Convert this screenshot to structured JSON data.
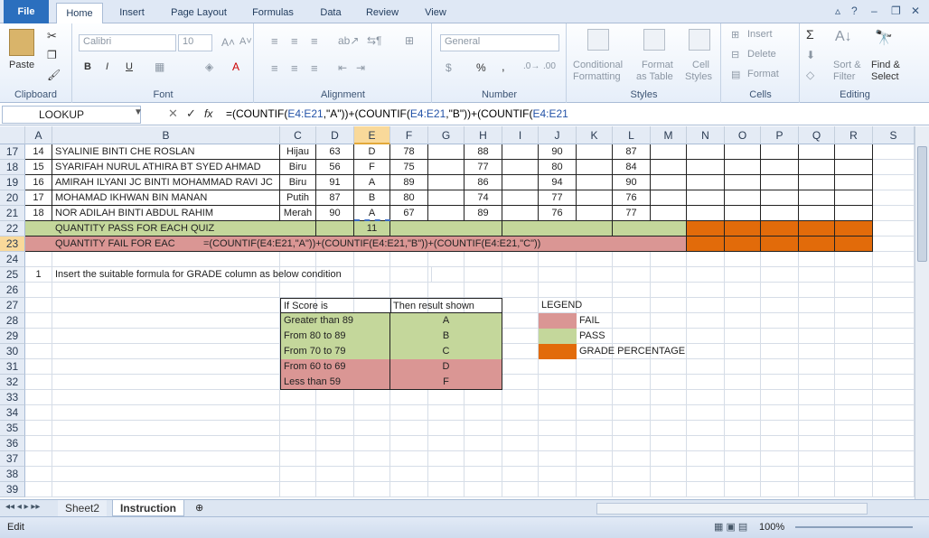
{
  "tabs": {
    "file": "File",
    "home": "Home",
    "insert": "Insert",
    "page_layout": "Page Layout",
    "formulas": "Formulas",
    "data": "Data",
    "review": "Review",
    "view": "View"
  },
  "ribbon": {
    "clipboard": {
      "label": "Clipboard",
      "paste": "Paste"
    },
    "font": {
      "label": "Font",
      "name": "Calibri",
      "size": "10",
      "bold": "B",
      "italic": "I",
      "underline": "U"
    },
    "alignment": {
      "label": "Alignment"
    },
    "number": {
      "label": "Number",
      "format": "General",
      "percent": "%",
      "comma": ","
    },
    "styles": {
      "label": "Styles",
      "conditional": "Conditional",
      "conditional2": "Formatting",
      "format_as": "Format",
      "format_as2": "as Table",
      "cell": "Cell",
      "cell2": "Styles"
    },
    "cells": {
      "label": "Cells",
      "insert": "Insert",
      "delete": "Delete",
      "format": "Format"
    },
    "editing": {
      "label": "Editing",
      "sigma": "Σ",
      "sort": "Sort &",
      "sort2": "Filter",
      "find": "Find &",
      "find2": "Select"
    }
  },
  "formula_bar": {
    "name_box": "LOOKUP",
    "fx": "fx",
    "formula_parts": [
      "=(COUNTIF(",
      "E4:E21",
      ",\"A\"))+(COUNTIF(",
      "E4:E21",
      ",\"B\"))+(COUNTIF(",
      "E4:E21",
      ",\"C\"))"
    ]
  },
  "columns": [
    "A",
    "B",
    "C",
    "D",
    "E",
    "F",
    "G",
    "H",
    "I",
    "J",
    "K",
    "L",
    "M",
    "N",
    "O",
    "P",
    "Q",
    "R",
    "S"
  ],
  "rows": [
    "17",
    "18",
    "19",
    "20",
    "21",
    "22",
    "23",
    "24",
    "25",
    "26",
    "27",
    "28",
    "29",
    "30",
    "31",
    "32",
    "33",
    "34",
    "35",
    "36",
    "37",
    "38",
    "39"
  ],
  "students": [
    {
      "no": "14",
      "name": "SYALINIE BINTI CHE ROSLAN",
      "house": "Hijau",
      "d": "63",
      "e": "D",
      "f": "78",
      "h": "88",
      "j": "90",
      "l": "87"
    },
    {
      "no": "15",
      "name": "SYARIFAH NURUL ATHIRA BT SYED AHMAD",
      "house": "Biru",
      "d": "56",
      "e": "F",
      "f": "75",
      "h": "77",
      "j": "80",
      "l": "84"
    },
    {
      "no": "16",
      "name": "AMIRAH ILYANI JC BINTI MOHAMMAD RAVI JC",
      "house": "Biru",
      "d": "91",
      "e": "A",
      "f": "89",
      "h": "86",
      "j": "94",
      "l": "90"
    },
    {
      "no": "17",
      "name": "MOHAMAD IKHWAN BIN MANAN",
      "house": "Putih",
      "d": "87",
      "e": "B",
      "f": "80",
      "h": "74",
      "j": "77",
      "l": "76"
    },
    {
      "no": "18",
      "name": "NOR ADILAH BINTI ABDUL RAHIM",
      "house": "Merah",
      "d": "90",
      "e": "A",
      "f": "67",
      "h": "89",
      "j": "76",
      "l": "77"
    }
  ],
  "pass_row": {
    "label": "QUANTITY PASS FOR EACH QUIZ",
    "value": "11"
  },
  "fail_row": {
    "label": "QUANTITY FAIL FOR EAC",
    "formula": "=(COUNTIF(E4:E21,\"A\"))+(COUNTIF(E4:E21,\"B\"))+(COUNTIF(E4:E21,\"C\"))"
  },
  "instruction": {
    "num": "1",
    "text": "Insert the suitable formula for GRADE column as below condition"
  },
  "grade_table": {
    "h1": "If Score is",
    "h2": "Then result shown",
    "rows": [
      {
        "cond": "Greater than 89",
        "res": "A"
      },
      {
        "cond": "From 80 to 89",
        "res": "B"
      },
      {
        "cond": "From 70 to 79",
        "res": "C"
      },
      {
        "cond": "From 60 to 69",
        "res": "D"
      },
      {
        "cond": "Less than 59",
        "res": "F"
      }
    ]
  },
  "legend": {
    "title": "LEGEND",
    "fail": "FAIL",
    "pass": "PASS",
    "pct": "GRADE PERCENTAGE"
  },
  "sheets": {
    "sheet2": "Sheet2",
    "instruction": "Instruction"
  },
  "status": {
    "mode": "Edit",
    "zoom": "100%"
  },
  "colors": {
    "pass": "#c4d79b",
    "fail": "#da9694",
    "orange": "#e26b0a"
  }
}
